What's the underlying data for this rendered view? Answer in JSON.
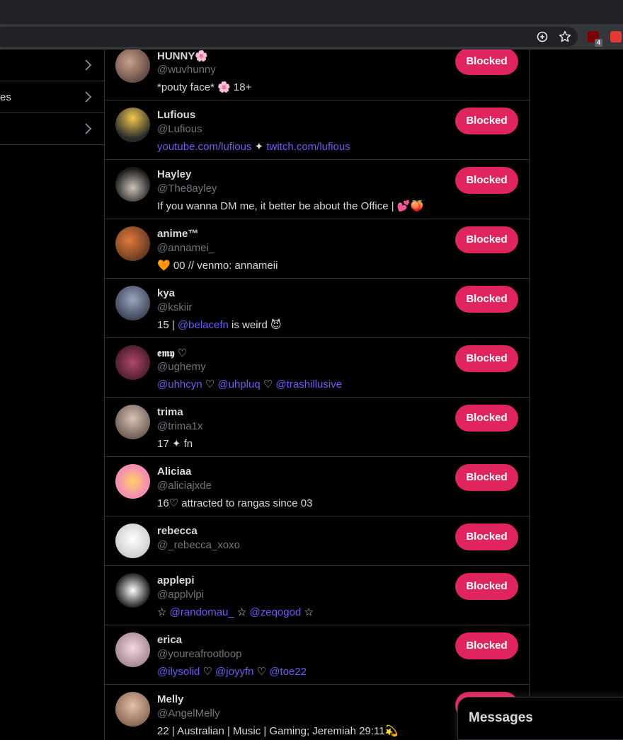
{
  "browser": {
    "icons": [
      "zoom-in-icon",
      "bookmark-star-icon",
      "ublock-icon",
      "extension-icon"
    ],
    "ublock_badge": "4"
  },
  "leftnav": {
    "items": [
      {
        "label": ""
      },
      {
        "label": "es"
      },
      {
        "label": ""
      }
    ]
  },
  "list": {
    "button_label": "Blocked",
    "accounts": [
      {
        "name": "HUNNY🌸",
        "handle": "@wuvhunny",
        "bio": [
          {
            "t": "*pouty face* 🌸 18+"
          }
        ]
      },
      {
        "name": "Lufious",
        "handle": "@Lufious",
        "bio": [
          {
            "t": "youtube.com/lufious",
            "link": true
          },
          {
            "t": " ✦ "
          },
          {
            "t": "twitch.com/lufious",
            "link": true
          }
        ]
      },
      {
        "name": "Hayley",
        "handle": "@The8ayley",
        "bio": [
          {
            "t": "If you wanna DM me, it better be about the Office | 💕🍑"
          }
        ]
      },
      {
        "name": "anime™",
        "handle": "@annamei_",
        "bio": [
          {
            "t": "🧡 00 // venmo: annameii"
          }
        ]
      },
      {
        "name": "kya",
        "handle": "@kskiir",
        "bio": [
          {
            "t": "15 | "
          },
          {
            "t": "@belacefn",
            "link": true
          },
          {
            "t": " is weird 😈"
          }
        ]
      },
      {
        "name": "𝖊𝖒𝖞 ♡",
        "handle": "@ughemy",
        "bio": [
          {
            "t": "@uhhcyn",
            "link": true
          },
          {
            "t": " ♡ "
          },
          {
            "t": "@uhpluq",
            "link": true
          },
          {
            "t": " ♡ "
          },
          {
            "t": "@trashillusive",
            "link": true
          }
        ]
      },
      {
        "name": "trima",
        "handle": "@trima1x",
        "bio": [
          {
            "t": "17 ✦ fn"
          }
        ]
      },
      {
        "name": "Aliciaa",
        "handle": "@aliciajxde",
        "bio": [
          {
            "t": "16♡ attracted to rangas since 03"
          }
        ]
      },
      {
        "name": "rebecca",
        "handle": "@_rebecca_xoxo",
        "bio": []
      },
      {
        "name": "applepi",
        "handle": "@applvlpi",
        "bio": [
          {
            "t": "☆ "
          },
          {
            "t": "@randomau_",
            "link": true
          },
          {
            "t": " ☆ "
          },
          {
            "t": "@zeqogod",
            "link": true
          },
          {
            "t": " ☆"
          }
        ]
      },
      {
        "name": "erica",
        "handle": "@youreafrootloop",
        "bio": [
          {
            "t": "@ilysolid",
            "link": true
          },
          {
            "t": " ♡ "
          },
          {
            "t": "@joyyfn",
            "link": true
          },
          {
            "t": " ♡ "
          },
          {
            "t": "@toe22",
            "link": true
          }
        ]
      },
      {
        "name": "Melly",
        "handle": "@AngelMelly",
        "bio": [
          {
            "t": "22 | Australian | Music | Gaming; Jeremiah 29:11💫"
          }
        ]
      }
    ]
  },
  "messages_label": "Messages",
  "colors": {
    "accent_button": "#e0245e",
    "link": "#6a5bf5",
    "border": "#2f3336"
  }
}
